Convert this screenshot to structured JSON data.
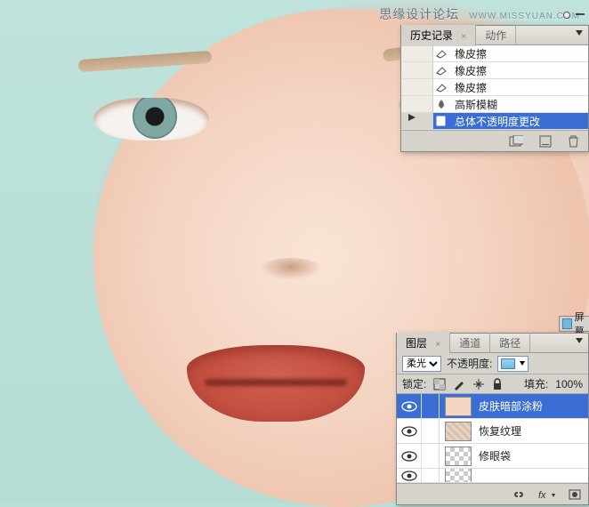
{
  "watermark": {
    "text": "思缘设计论坛",
    "url": "WWW.MISSYUAN.COM"
  },
  "history": {
    "tabs": [
      {
        "label": "历史记录",
        "active": true
      },
      {
        "label": "动作",
        "active": false
      }
    ],
    "items": [
      {
        "icon": "eraser",
        "label": "橡皮擦"
      },
      {
        "icon": "eraser",
        "label": "橡皮擦"
      },
      {
        "icon": "eraser",
        "label": "橡皮擦"
      },
      {
        "icon": "blur",
        "label": "高斯模糊"
      },
      {
        "icon": "doc",
        "label": "总体不透明度更改",
        "selected": true
      }
    ]
  },
  "layers": {
    "tabs": [
      {
        "label": "图层",
        "active": true
      },
      {
        "label": "通道",
        "active": false
      },
      {
        "label": "路径",
        "active": false
      }
    ],
    "blend_mode": "柔光",
    "opacity_label": "不透明度:",
    "lock_label": "锁定:",
    "fill_label": "填充:",
    "fill_value": "100%",
    "items": [
      {
        "thumb": "skin",
        "name": "皮肤暗部涂粉",
        "selected": true
      },
      {
        "thumb": "tex",
        "name": "恢复纹理"
      },
      {
        "thumb": "chk",
        "name": "修眼袋"
      }
    ]
  },
  "side_chip": {
    "label": "屏幕"
  }
}
